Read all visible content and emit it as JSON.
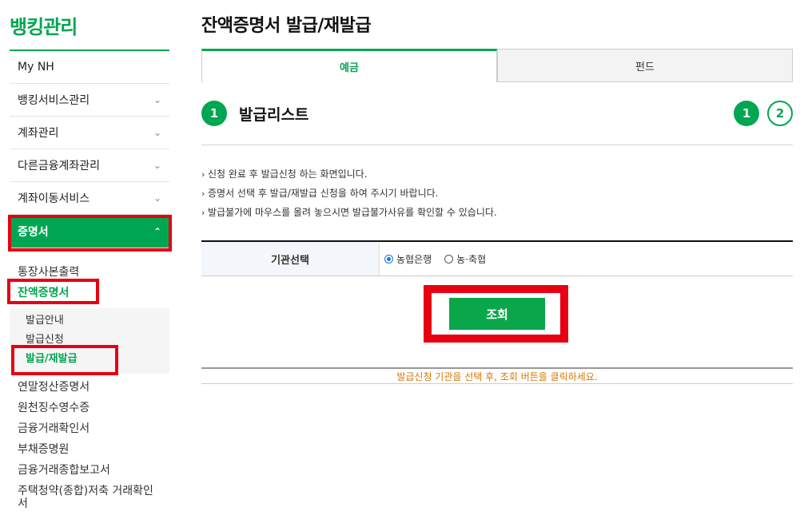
{
  "sidebar": {
    "brand": "뱅킹관리",
    "menu": [
      {
        "label": "My NH",
        "chevron": ""
      },
      {
        "label": "뱅킹서비스관리",
        "chevron": "⌄"
      },
      {
        "label": "계좌관리",
        "chevron": "⌄"
      },
      {
        "label": "다른금융계좌관리",
        "chevron": "⌄"
      },
      {
        "label": "계좌이동서비스",
        "chevron": "⌄"
      },
      {
        "label": "증명서",
        "chevron": "⌃"
      }
    ],
    "sub": {
      "item0": "통장사본출력",
      "item1": "잔액증명서",
      "subsub": [
        "발급안내",
        "발급신청",
        "발급/재발급"
      ],
      "tail": [
        "연말정산증명서",
        "원천징수영수증",
        "금융거래확인서",
        "부채증명원",
        "금융거래종합보고서",
        "주택청약(종합)저축 거래확인서"
      ]
    }
  },
  "main": {
    "title": "잔액증명서 발급/재발급",
    "tabs": [
      "예금",
      "펀드"
    ],
    "step": {
      "number": "1",
      "title": "발급리스트",
      "indicators": [
        "1",
        "2"
      ]
    },
    "notices": [
      "신청 완료 후 발급신청 하는 화면입니다.",
      "증명서 선택 후 발급/재발급 신청을 하여 주시기 바랍니다.",
      "발급불가에 마우스를 올려 놓으시면 발급불가사유를 확인할 수 있습니다."
    ],
    "notice_marker": "›",
    "form": {
      "label": "기관선택",
      "options": [
        {
          "label": "농협은행",
          "selected": true
        },
        {
          "label": "농·축협",
          "selected": false
        }
      ]
    },
    "search_button": "조회",
    "result_message": "발급신청 기관을 선택 후, 조회 버튼을 클릭하세요."
  },
  "colors": {
    "accent": "#00a651",
    "highlight": "#e60012",
    "message": "#d4780a"
  }
}
